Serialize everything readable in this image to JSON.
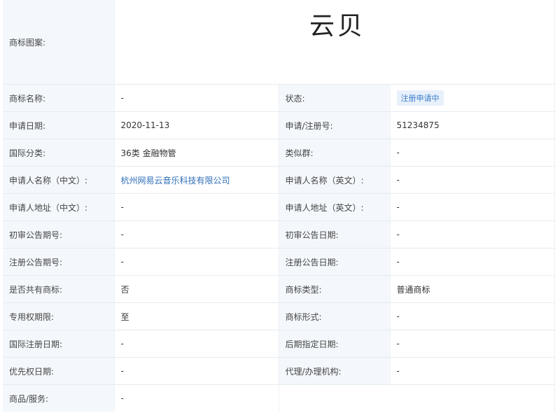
{
  "trademark": {
    "image_label": "商标图案:",
    "image_text": "云贝"
  },
  "rows": [
    {
      "l1": "商标名称:",
      "v1": "-",
      "l2": "状态:",
      "v2": "注册申请中"
    },
    {
      "l1": "申请日期:",
      "v1": "2020-11-13",
      "l2": "申请/注册号:",
      "v2": "51234875"
    },
    {
      "l1": "国际分类:",
      "v1": "36类 金融物管",
      "l2": "类似群:",
      "v2": "-"
    },
    {
      "l1": "申请人名称（中文）:",
      "v1": "杭州网易云音乐科技有限公司",
      "l2": "申请人名称（英文）:",
      "v2": "-"
    },
    {
      "l1": "申请人地址（中文）:",
      "v1": "-",
      "l2": "申请人地址（英文）:",
      "v2": "-"
    },
    {
      "l1": "初审公告期号:",
      "v1": "-",
      "l2": "初审公告日期:",
      "v2": "-"
    },
    {
      "l1": "注册公告期号:",
      "v1": "-",
      "l2": "注册公告日期:",
      "v2": "-"
    },
    {
      "l1": "是否共有商标:",
      "v1": "否",
      "l2": "商标类型:",
      "v2": "普通商标"
    },
    {
      "l1": "专用权期限:",
      "v1": "至",
      "l2": "商标形式:",
      "v2": "-"
    },
    {
      "l1": "国际注册日期:",
      "v1": "-",
      "l2": "后期指定日期:",
      "v2": "-"
    },
    {
      "l1": "优先权日期:",
      "v1": "-",
      "l2": "代理/办理机构:",
      "v2": "-"
    }
  ],
  "goods": {
    "label": "商品/服务:",
    "value": "-"
  },
  "colors": {
    "label_bg": "#f4f8fc",
    "link": "#2f6fb8",
    "badge_bg": "#e8f1fb",
    "badge_text": "#3a7bc8"
  }
}
